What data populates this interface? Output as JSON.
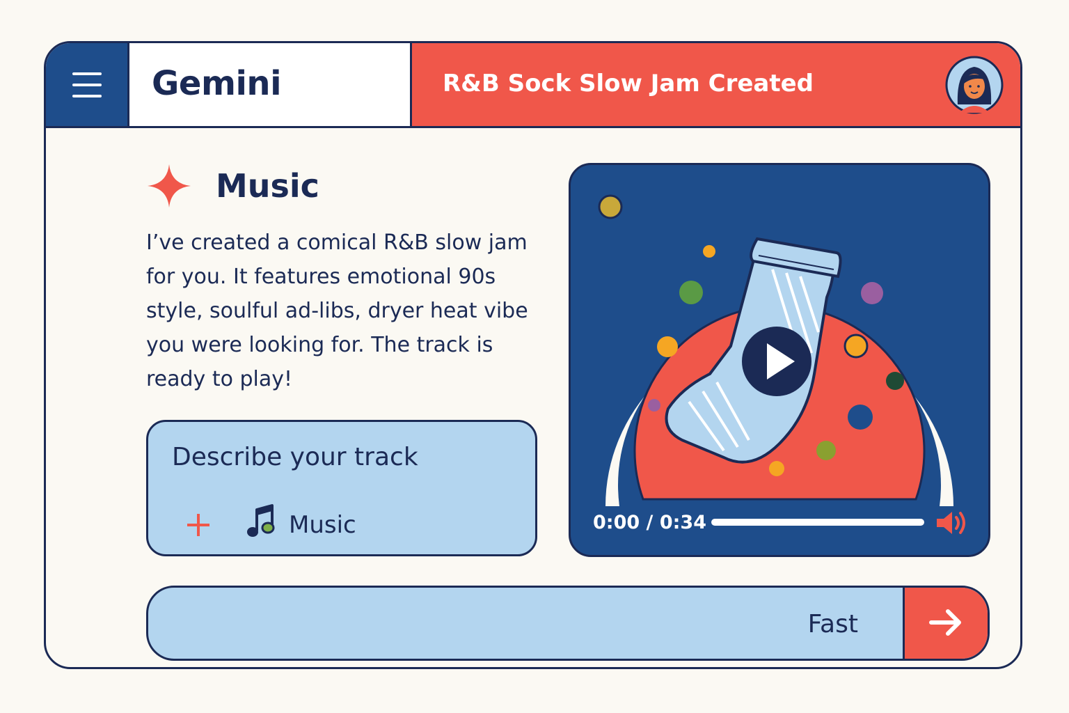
{
  "header": {
    "brand": "Gemini",
    "chat_title": "R&B Sock Slow Jam Created"
  },
  "content": {
    "section_title": "Music",
    "message": "I’ve created a comical R&B slow jam for you. It features emotional 90s style, soulful ad-libs, dryer heat vibe you were looking for. The track is ready to play!"
  },
  "prompt_card": {
    "placeholder": "Describe your track",
    "chip_label": "Music"
  },
  "player": {
    "time": "0:00 / 0:34",
    "progress": 0
  },
  "input_bar": {
    "mode": "Fast"
  },
  "colors": {
    "navy": "#1b2a55",
    "blue": "#1e4d8b",
    "coral": "#f0574a",
    "light_blue": "#b3d5ef"
  }
}
